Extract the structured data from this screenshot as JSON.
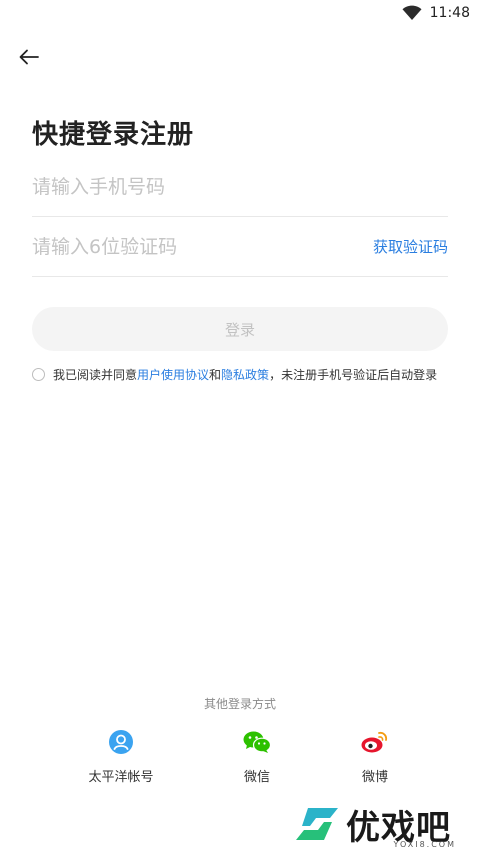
{
  "status_bar": {
    "time": "11:48"
  },
  "header": {
    "back_icon": "arrow-left-icon"
  },
  "title": "快捷登录注册",
  "phone": {
    "value": "",
    "placeholder": "请输入手机号码"
  },
  "code": {
    "value": "",
    "placeholder": "请输入6位验证码",
    "get_code_label": "获取验证码"
  },
  "login_button": {
    "label": "登录"
  },
  "agreement": {
    "checked": false,
    "prefix": "我已阅读并同意",
    "user_agreement": "用户使用协议",
    "and": "和",
    "privacy_policy": "隐私政策",
    "suffix": "，未注册手机号验证后自动登录"
  },
  "other_login": {
    "label": "其他登录方式",
    "options": [
      {
        "label": "太平洋帐号",
        "icon": "user-circle-icon",
        "color": "#3aa3f0"
      },
      {
        "label": "微信",
        "icon": "wechat-icon",
        "color": "#2dc100"
      },
      {
        "label": "微博",
        "icon": "weibo-icon",
        "color": "#e6162d"
      }
    ]
  },
  "colors": {
    "accent": "#2a7ee0",
    "placeholder": "#c4c4c4",
    "button_bg": "#f4f4f4"
  },
  "watermark": {
    "text": "优戏吧",
    "sub": "YOXI8.COM"
  }
}
